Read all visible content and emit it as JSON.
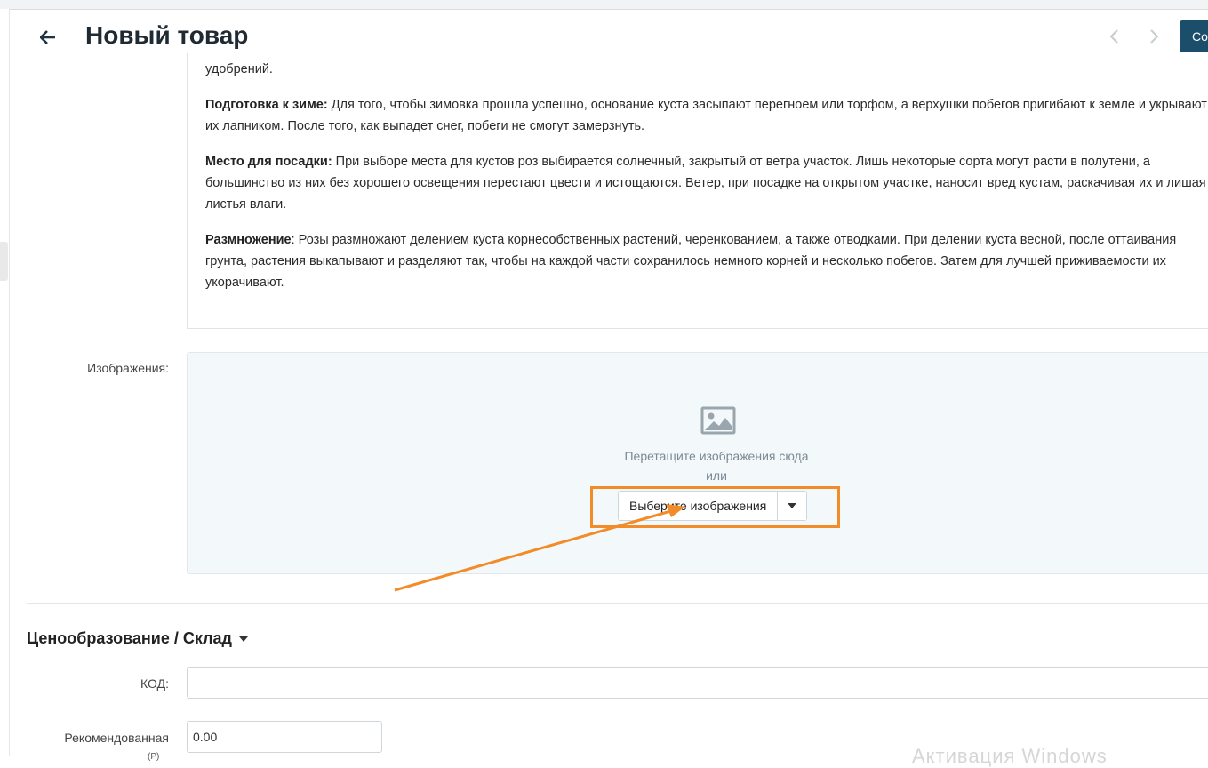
{
  "header": {
    "title": "Новый товар",
    "save_label": "Со"
  },
  "description": {
    "paragraphs": [
      {
        "lead": "",
        "text": "удобрений."
      },
      {
        "lead": "Подготовка к зиме:",
        "text": " Для того, чтобы зимовка прошла успешно, основание куста засыпают перегноем или торфом, а верхушки побегов пригибают к земле и укрывают их лапником. После того, как выпадет снег, побеги не смогут замерзнуть."
      },
      {
        "lead": "Место для посадки:",
        "text": " При выборе места для кустов роз выбирается солнечный, закрытый от ветра участок. Лишь некоторые сорта могут расти в полутени, а большинство из них без хорошего освещения перестают цвести и истощаются. Ветер, при посадке на открытом участке, наносит вред кустам, раскачивая их и лишая листья влаги."
      },
      {
        "lead": "Размножение",
        "text": ": Розы размножают делением куста корнесобственных растений, черенкованием, а также отводками. При делении куста весной, после оттаивания грунта, растения выкапывают и разделяют так, чтобы на каждой части сохранилось немного корней и несколько побегов. Затем для лучшей приживаемости их укорачивают."
      }
    ]
  },
  "images": {
    "label": "Изображения:",
    "drop_hint": "Перетащите изображения сюда",
    "or_text": "или",
    "choose_label": "Выберите изображения"
  },
  "pricing": {
    "section_title": "Ценообразование / Склад",
    "code_label": "КОД:",
    "code_value": "",
    "recommended_label": "Рекомендованная",
    "recommended_label_cut": "(Р)",
    "recommended_value": "0.00"
  },
  "watermark": "Активация Windows",
  "colors": {
    "accent": "#1b4e6b",
    "annotation": "#f28c28",
    "dropzone_bg": "#f3f8fb"
  },
  "icons": {
    "back": "arrow-left-icon",
    "prev": "chevron-left-icon",
    "next": "chevron-right-icon",
    "image": "image-icon",
    "caret": "caret-down-icon"
  }
}
